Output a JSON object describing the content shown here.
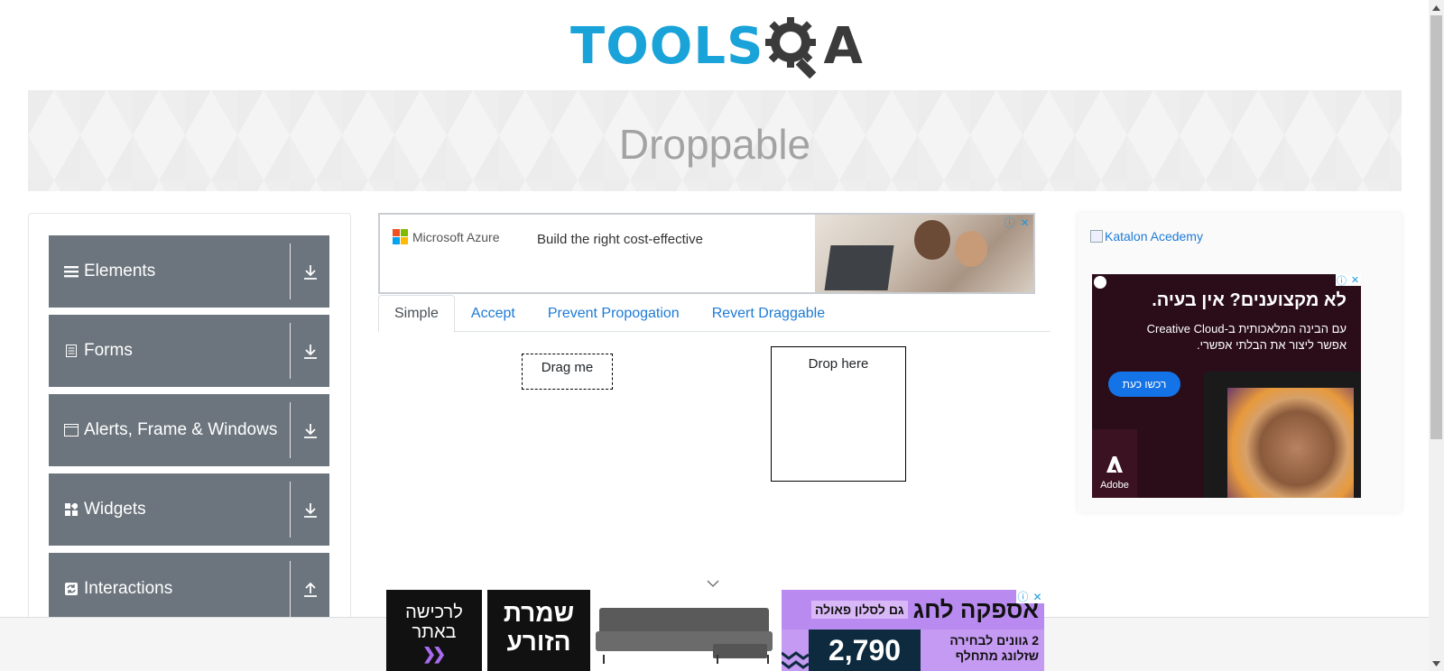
{
  "logo": {
    "text": "TOOLS",
    "suffix": "A",
    "brand_color": "#1aa3d9"
  },
  "page": {
    "title": "Droppable"
  },
  "sidebar": {
    "items": [
      {
        "label": "Elements",
        "icon": "list-icon",
        "arrow": "download-icon"
      },
      {
        "label": "Forms",
        "icon": "document-icon",
        "arrow": "download-icon"
      },
      {
        "label": "Alerts, Frame & Windows",
        "icon": "window-icon",
        "arrow": "download-icon"
      },
      {
        "label": "Widgets",
        "icon": "widgets-icon",
        "arrow": "download-icon"
      },
      {
        "label": "Interactions",
        "icon": "sync-icon",
        "arrow": "upload-icon"
      }
    ]
  },
  "top_ad": {
    "brand": "Microsoft Azure",
    "headline": "Build the right cost-effective",
    "info_icon": "ⓘ",
    "close_icon": "✕"
  },
  "tabs": [
    {
      "label": "Simple",
      "active": true
    },
    {
      "label": "Accept",
      "active": false
    },
    {
      "label": "Prevent Propogation",
      "active": false
    },
    {
      "label": "Revert Draggable",
      "active": false
    }
  ],
  "simple": {
    "drag_label": "Drag me",
    "drop_label": "Drop here"
  },
  "right_ad": {
    "broken_image_alt": "Katalon Acedemy",
    "headline": "לא מקצוענים? אין בעיה.",
    "sub_line1": "עם הבינה המלאכותית ב-Creative Cloud",
    "sub_line2": "אפשר ליצור את הבלתי אפשרי.",
    "cta": "רכשו כעת",
    "brand": "Adobe"
  },
  "bottom_ad": {
    "box1_line1": "לרכישה",
    "box1_line2": "באתר",
    "box2_line1": "שמרת",
    "box2_line2": "הזורע",
    "headline": "אספקה לחג",
    "headline_tag": "גם לסלון פאולה",
    "price": "2,790",
    "desc_line1": "2 גוונים לבחירה",
    "desc_line2": "שזלונג מתחלף"
  },
  "colors": {
    "menu_bg": "#6c757d",
    "tab_link": "#1e7bd6",
    "banner_title": "#a3a3a3"
  }
}
